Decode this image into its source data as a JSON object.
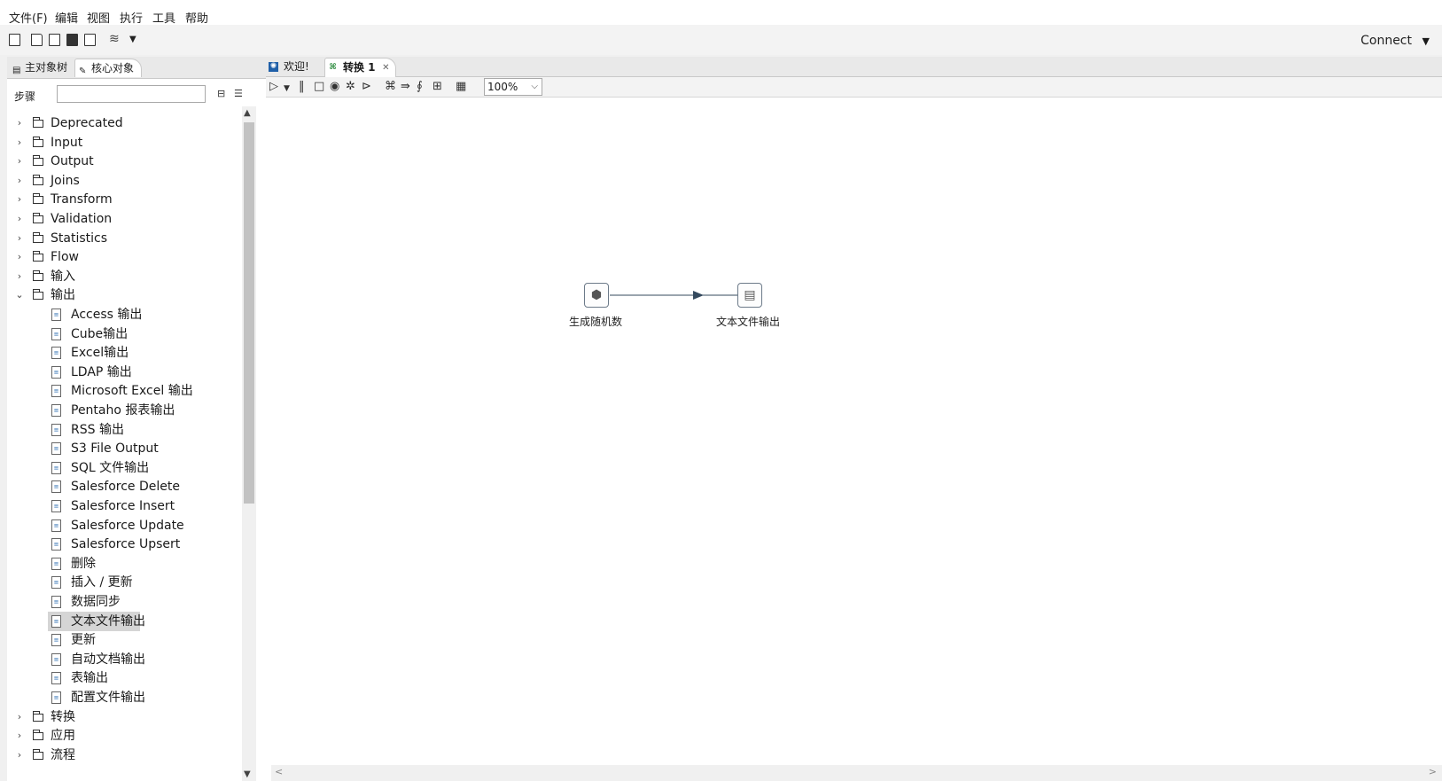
{
  "menubar": {
    "items": [
      "文件(F)",
      "编辑",
      "视图",
      "执行",
      "工具",
      "帮助"
    ]
  },
  "toolbar": {
    "connect_label": "Connect"
  },
  "left_panel": {
    "tabs": [
      "主对象树",
      "核心对象"
    ],
    "steps_label": "步骤",
    "search_value": "",
    "tree": [
      {
        "label": "Deprecated",
        "type": "folder",
        "expanded": false
      },
      {
        "label": "Input",
        "type": "folder",
        "expanded": false
      },
      {
        "label": "Output",
        "type": "folder",
        "expanded": false
      },
      {
        "label": "Joins",
        "type": "folder",
        "expanded": false
      },
      {
        "label": "Transform",
        "type": "folder",
        "expanded": false
      },
      {
        "label": "Validation",
        "type": "folder",
        "expanded": false
      },
      {
        "label": "Statistics",
        "type": "folder",
        "expanded": false
      },
      {
        "label": "Flow",
        "type": "folder",
        "expanded": false
      },
      {
        "label": "输入",
        "type": "folder",
        "expanded": false
      },
      {
        "label": "输出",
        "type": "folder",
        "expanded": true
      },
      {
        "label": "Access 输出",
        "type": "leaf"
      },
      {
        "label": "Cube输出",
        "type": "leaf"
      },
      {
        "label": "Excel输出",
        "type": "leaf"
      },
      {
        "label": "LDAP 输出",
        "type": "leaf"
      },
      {
        "label": "Microsoft Excel 输出",
        "type": "leaf"
      },
      {
        "label": "Pentaho 报表输出",
        "type": "leaf"
      },
      {
        "label": "RSS 输出",
        "type": "leaf"
      },
      {
        "label": "S3 File Output",
        "type": "leaf"
      },
      {
        "label": "SQL 文件输出",
        "type": "leaf"
      },
      {
        "label": "Salesforce Delete",
        "type": "leaf"
      },
      {
        "label": "Salesforce Insert",
        "type": "leaf"
      },
      {
        "label": "Salesforce Update",
        "type": "leaf"
      },
      {
        "label": "Salesforce Upsert",
        "type": "leaf"
      },
      {
        "label": "删除",
        "type": "leaf"
      },
      {
        "label": "插入 / 更新",
        "type": "leaf"
      },
      {
        "label": "数据同步",
        "type": "leaf"
      },
      {
        "label": "文本文件输出",
        "type": "leaf",
        "selected": true
      },
      {
        "label": "更新",
        "type": "leaf"
      },
      {
        "label": "自动文档输出",
        "type": "leaf"
      },
      {
        "label": "表输出",
        "type": "leaf"
      },
      {
        "label": "配置文件输出",
        "type": "leaf"
      },
      {
        "label": "转换",
        "type": "folder",
        "expanded": false
      },
      {
        "label": "应用",
        "type": "folder",
        "expanded": false
      },
      {
        "label": "流程",
        "type": "folder",
        "expanded": false
      }
    ]
  },
  "editor": {
    "tabs": [
      {
        "label": "欢迎!",
        "active": false
      },
      {
        "label": "转换 1",
        "active": true
      }
    ],
    "zoom": "100%",
    "steps": [
      {
        "label": "生成随机数",
        "icon": "random-generator-icon"
      },
      {
        "label": "文本文件输出",
        "icon": "text-file-output-icon"
      }
    ]
  },
  "colors": {
    "hop_line": "#34495e",
    "selection": "#d5d5d5"
  }
}
